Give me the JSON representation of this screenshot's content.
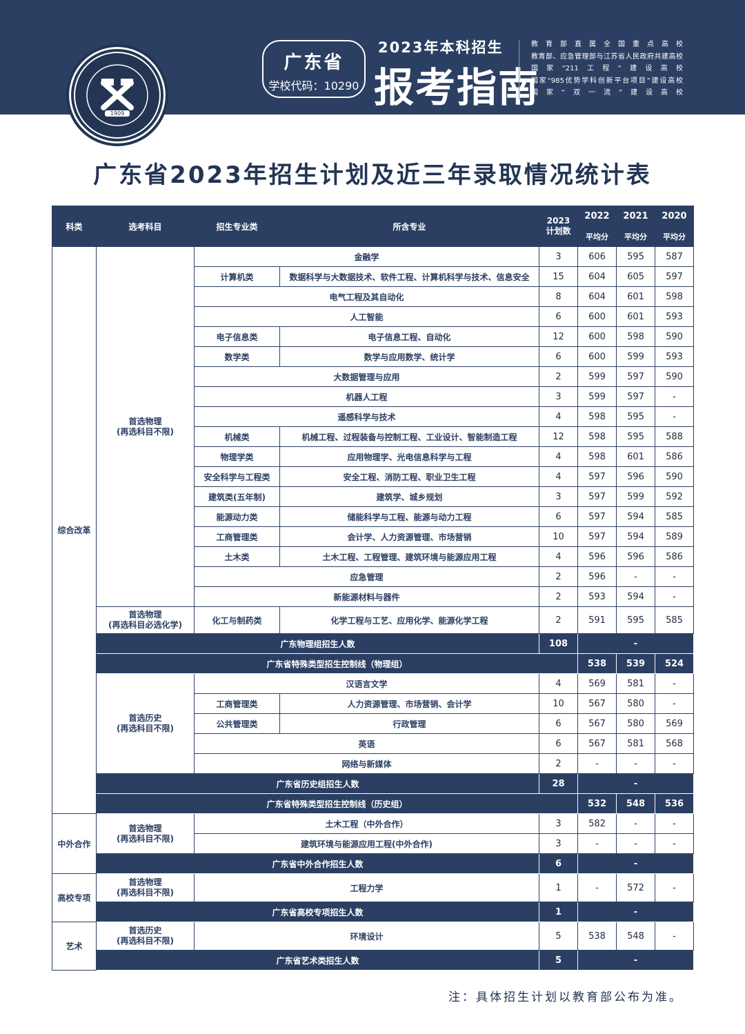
{
  "header": {
    "province": "广东省",
    "school_code": "学校代码：10290",
    "year_line": "2023年本科招生",
    "guide_title": "报考指南",
    "honors": [
      "教育部直属全国重点高校",
      "教育部、应急管理部与江苏省人民政府共建高校",
      "国家“211工程”建设高校",
      "国家“985优势学科创新平台项目”建设高校",
      "国家“双一流”建设高校"
    ],
    "logo_year": "1909",
    "logo_en": "CHINA UNIVERSITY OF MINING AND TECHNOLOGY",
    "colors": {
      "brand": "#2b3f63",
      "text": "#1f2a3d"
    }
  },
  "page": {
    "title": "广东省2023年招生计划及近三年录取情况统计表",
    "note": "注：具体招生计划以教育部公布为准。"
  },
  "table": {
    "headers": {
      "category": "科类",
      "subjects": "选考科目",
      "major_group": "招生专业类",
      "majors": "所含专业",
      "plan_year": "2023",
      "plan_label": "计划数",
      "y2022": "2022",
      "y2021": "2021",
      "y2020": "2020",
      "avg": "平均分"
    },
    "categories": {
      "zonghe": "综合改革",
      "zhongwai": "中外合作",
      "gaoxiao": "高校专项",
      "yishu": "艺术"
    },
    "subject_groups": {
      "phys_free_1": "首选物理",
      "phys_free_2": "(再选科目不限)",
      "phys_chem_1": "首选物理",
      "phys_chem_2": "(再选科目必选化学)",
      "hist_free_1": "首选历史",
      "hist_free_2": "(再选科目不限)",
      "zw_1": "首选物理",
      "zw_2": "(再选科目不限)",
      "gx_1": "首选物理",
      "gx_2": "(再选科目不限)",
      "ys_1": "首选历史",
      "ys_2": "(再选科目不限)"
    },
    "physics_rows": [
      {
        "group": "",
        "majors": "金融学",
        "plan": "3",
        "s2022": "606",
        "s2021": "595",
        "s2020": "587"
      },
      {
        "group": "计算机类",
        "majors": "数据科学与大数据技术、软件工程、计算机科学与技术、信息安全",
        "plan": "15",
        "s2022": "604",
        "s2021": "605",
        "s2020": "597"
      },
      {
        "group": "",
        "majors": "电气工程及其自动化",
        "plan": "8",
        "s2022": "604",
        "s2021": "601",
        "s2020": "598"
      },
      {
        "group": "",
        "majors": "人工智能",
        "plan": "6",
        "s2022": "600",
        "s2021": "601",
        "s2020": "593"
      },
      {
        "group": "电子信息类",
        "majors": "电子信息工程、自动化",
        "plan": "12",
        "s2022": "600",
        "s2021": "598",
        "s2020": "590"
      },
      {
        "group": "数学类",
        "majors": "数学与应用数学、统计学",
        "plan": "6",
        "s2022": "600",
        "s2021": "599",
        "s2020": "593"
      },
      {
        "group": "",
        "majors": "大数据管理与应用",
        "plan": "2",
        "s2022": "599",
        "s2021": "597",
        "s2020": "590"
      },
      {
        "group": "",
        "majors": "机器人工程",
        "plan": "3",
        "s2022": "599",
        "s2021": "597",
        "s2020": "-"
      },
      {
        "group": "",
        "majors": "遥感科学与技术",
        "plan": "4",
        "s2022": "598",
        "s2021": "595",
        "s2020": "-"
      },
      {
        "group": "机械类",
        "majors": "机械工程、过程装备与控制工程、工业设计、智能制造工程",
        "plan": "12",
        "s2022": "598",
        "s2021": "595",
        "s2020": "588"
      },
      {
        "group": "物理学类",
        "majors": "应用物理学、光电信息科学与工程",
        "plan": "4",
        "s2022": "598",
        "s2021": "601",
        "s2020": "586"
      },
      {
        "group": "安全科学与工程类",
        "majors": "安全工程、消防工程、职业卫生工程",
        "plan": "4",
        "s2022": "597",
        "s2021": "596",
        "s2020": "590"
      },
      {
        "group": "建筑类(五年制)",
        "majors": "建筑学、城乡规划",
        "plan": "3",
        "s2022": "597",
        "s2021": "599",
        "s2020": "592"
      },
      {
        "group": "能源动力类",
        "majors": "储能科学与工程、能源与动力工程",
        "plan": "6",
        "s2022": "597",
        "s2021": "594",
        "s2020": "585"
      },
      {
        "group": "工商管理类",
        "majors": "会计学、人力资源管理、市场营销",
        "plan": "10",
        "s2022": "597",
        "s2021": "594",
        "s2020": "589"
      },
      {
        "group": "土木类",
        "majors": "土木工程、工程管理、建筑环境与能源应用工程",
        "plan": "4",
        "s2022": "596",
        "s2021": "596",
        "s2020": "586"
      },
      {
        "group": "",
        "majors": "应急管理",
        "plan": "2",
        "s2022": "596",
        "s2021": "-",
        "s2020": "-"
      },
      {
        "group": "",
        "majors": "新能源材料与器件",
        "plan": "2",
        "s2022": "593",
        "s2021": "594",
        "s2020": "-"
      }
    ],
    "chem_row": {
      "group": "化工与制药类",
      "majors": "化学工程与工艺、应用化学、能源化学工程",
      "plan": "2",
      "s2022": "591",
      "s2021": "595",
      "s2020": "585"
    },
    "physics_total": {
      "label": "广东物理组招生人数",
      "value": "108",
      "dash": "-"
    },
    "physics_control": {
      "label": "广东省特殊类型招生控制线（物理组）",
      "s2022": "538",
      "s2021": "539",
      "s2020": "524"
    },
    "history_rows": [
      {
        "group": "",
        "majors": "汉语言文学",
        "plan": "4",
        "s2022": "569",
        "s2021": "581",
        "s2020": "-"
      },
      {
        "group": "工商管理类",
        "majors": "人力资源管理、市场营销、会计学",
        "plan": "10",
        "s2022": "567",
        "s2021": "580",
        "s2020": "-"
      },
      {
        "group": "公共管理类",
        "majors": "行政管理",
        "plan": "6",
        "s2022": "567",
        "s2021": "580",
        "s2020": "569"
      },
      {
        "group": "",
        "majors": "英语",
        "plan": "6",
        "s2022": "567",
        "s2021": "581",
        "s2020": "568"
      },
      {
        "group": "",
        "majors": "网络与新媒体",
        "plan": "2",
        "s2022": "-",
        "s2021": "-",
        "s2020": "-"
      }
    ],
    "history_total": {
      "label": "广东省历史组招生人数",
      "value": "28",
      "dash": "-"
    },
    "history_control": {
      "label": "广东省特殊类型招生控制线（历史组）",
      "s2022": "532",
      "s2021": "548",
      "s2020": "536"
    },
    "zw_rows": [
      {
        "majors": "土木工程（中外合作）",
        "plan": "3",
        "s2022": "582",
        "s2021": "-",
        "s2020": "-"
      },
      {
        "majors": "建筑环境与能源应用工程(中外合作)",
        "plan": "3",
        "s2022": "-",
        "s2021": "-",
        "s2020": "-"
      }
    ],
    "zw_total": {
      "label": "广东省中外合作招生人数",
      "value": "6",
      "dash": "-"
    },
    "gx_row": {
      "majors": "工程力学",
      "plan": "1",
      "s2022": "-",
      "s2021": "572",
      "s2020": "-"
    },
    "gx_total": {
      "label": "广东省高校专项招生人数",
      "value": "1",
      "dash": "-"
    },
    "ys_row": {
      "majors": "环境设计",
      "plan": "5",
      "s2022": "538",
      "s2021": "548",
      "s2020": "-"
    },
    "ys_total": {
      "label": "广东省艺术类招生人数",
      "value": "5",
      "dash": "-"
    }
  }
}
